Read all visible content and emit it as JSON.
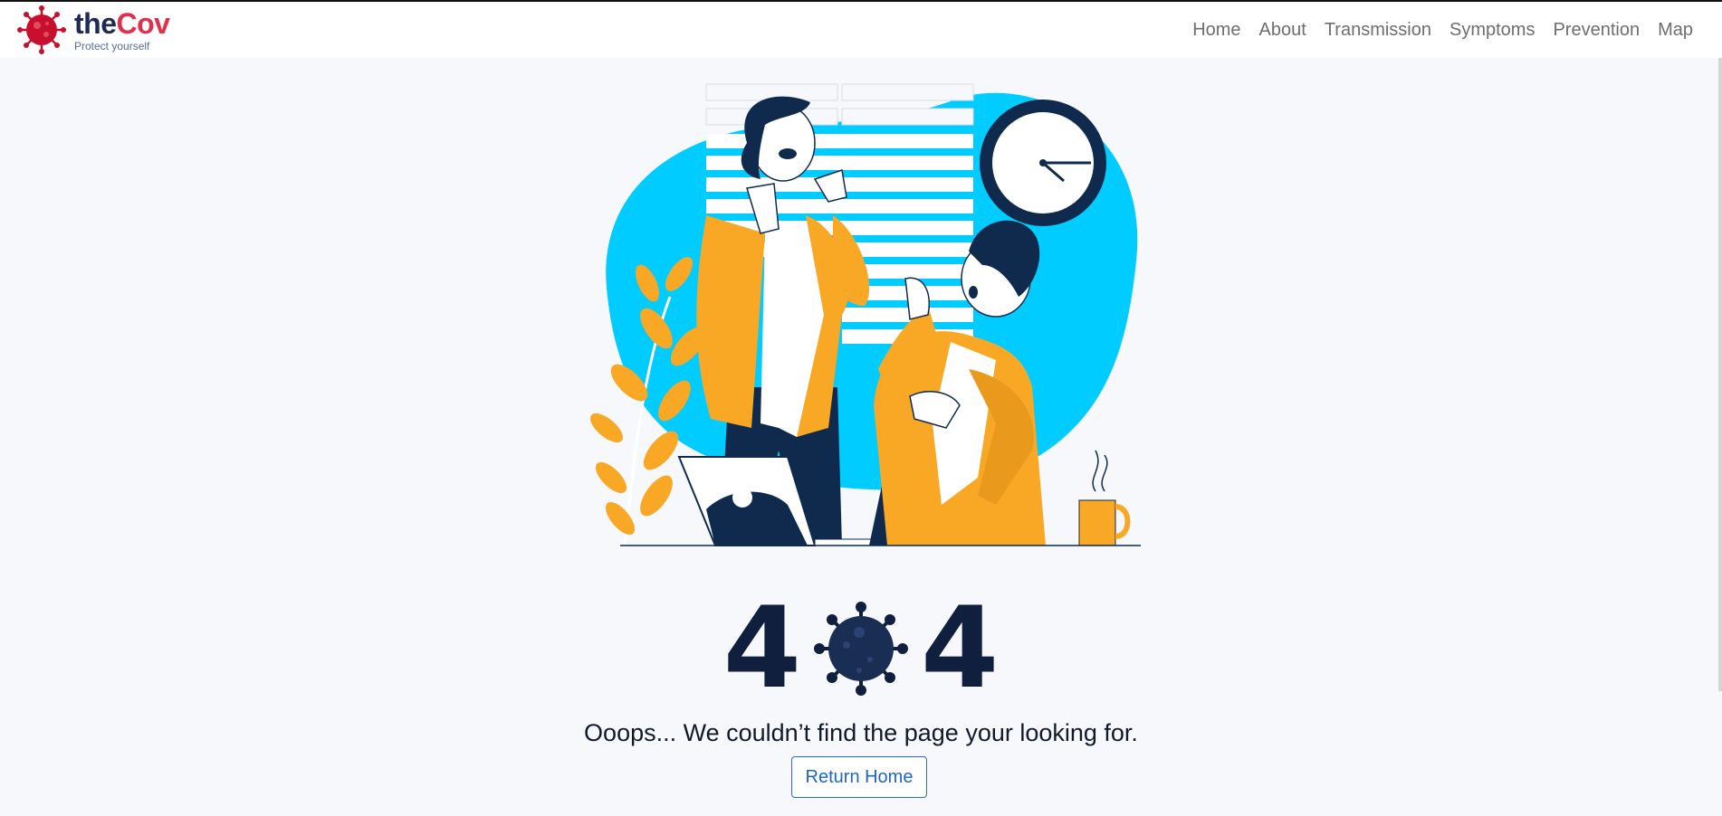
{
  "brand": {
    "name_part1": "the",
    "name_part2": "Cov",
    "tagline": "Protect yourself",
    "logo_icon": "virus-icon"
  },
  "nav": {
    "items": [
      {
        "label": "Home"
      },
      {
        "label": "About"
      },
      {
        "label": "Transmission"
      },
      {
        "label": "Symptoms"
      },
      {
        "label": "Prevention"
      },
      {
        "label": "Map"
      }
    ]
  },
  "error": {
    "digit_left": "4",
    "digit_right": "4",
    "middle_icon": "virus-icon",
    "message": "Ooops... We couldn’t find the page your looking for.",
    "button_label": "Return Home"
  },
  "colors": {
    "brand_red": "#e0314a",
    "brand_navy": "#1f2a55",
    "accent_cyan": "#00ccff",
    "accent_orange": "#f9a826",
    "dark_navy": "#0f1f3d",
    "link_blue": "#1b67c4"
  }
}
